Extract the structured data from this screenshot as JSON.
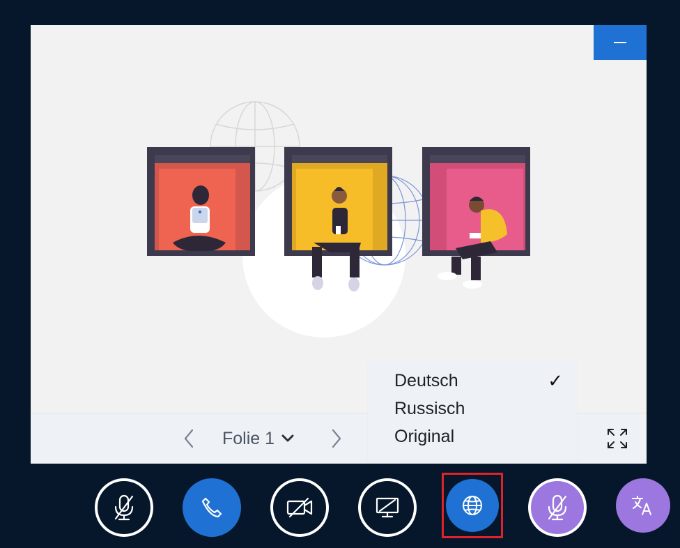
{
  "stage": {
    "minimize_icon": "minimize-icon",
    "illustration": "people-sitting-in-windows-illustration"
  },
  "slide_nav": {
    "slide_label": "Folie 1",
    "prev_icon": "chevron-left-icon",
    "next_icon": "chevron-right-icon",
    "dropdown_icon": "chevron-down-icon",
    "fullscreen_icon": "fullscreen-icon"
  },
  "language_menu": {
    "items": [
      {
        "label": "Deutsch",
        "selected": true
      },
      {
        "label": "Russisch",
        "selected": false
      },
      {
        "label": "Original",
        "selected": false
      }
    ],
    "check_mark": "✓"
  },
  "controls": {
    "buttons": [
      {
        "name": "mute-microphone",
        "icon": "microphone-off-icon"
      },
      {
        "name": "call",
        "icon": "phone-icon"
      },
      {
        "name": "camera",
        "icon": "camera-off-icon"
      },
      {
        "name": "screen-share",
        "icon": "screen-share-off-icon"
      },
      {
        "name": "language",
        "icon": "globe-icon",
        "highlighted": true
      },
      {
        "name": "interpreter-microphone",
        "icon": "microphone-off-icon"
      },
      {
        "name": "translate",
        "icon": "translate-icon"
      }
    ]
  },
  "colors": {
    "background": "#06172b",
    "accent_blue": "#1f72d3",
    "accent_purple": "#9b77df",
    "highlight_red": "#e0222a"
  }
}
